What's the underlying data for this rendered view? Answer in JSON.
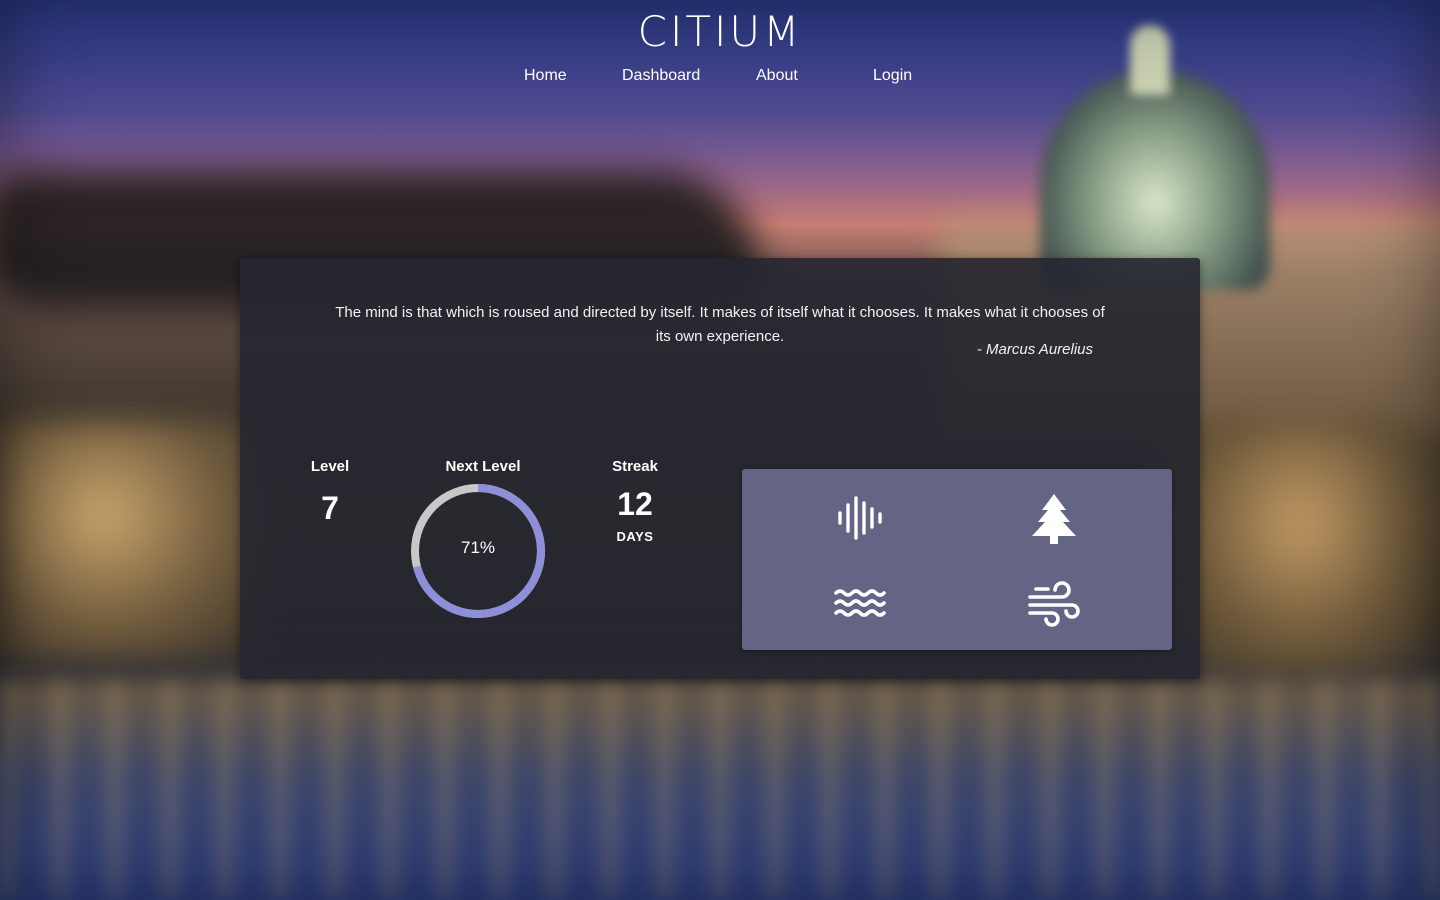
{
  "brand": {
    "logo_text": "CITIUM"
  },
  "nav": {
    "items": [
      {
        "label": "Home"
      },
      {
        "label": "Dashboard"
      },
      {
        "label": "About"
      },
      {
        "label": "Login"
      }
    ]
  },
  "quote": {
    "text": "The mind is that which is roused and directed by itself. It makes of itself what it chooses. It makes what it chooses of its own experience.",
    "author": "- Marcus Aurelius"
  },
  "stats": {
    "level": {
      "label": "Level",
      "value": "7"
    },
    "next_level": {
      "label": "Next Level",
      "progress_text": "71%",
      "progress_fraction": 0.71
    },
    "streak": {
      "label": "Streak",
      "value": "12",
      "unit": "DAYS"
    }
  },
  "sounds": {
    "items": [
      {
        "icon": "soundwave-icon"
      },
      {
        "icon": "tree-icon"
      },
      {
        "icon": "waves-icon"
      },
      {
        "icon": "wind-icon"
      }
    ]
  },
  "colors": {
    "panel_bg": "#252630",
    "progress_accent": "#8e8fd8",
    "progress_track": "#c8c8c8",
    "sound_panel_bg": "#646584",
    "text": "#ffffff"
  }
}
